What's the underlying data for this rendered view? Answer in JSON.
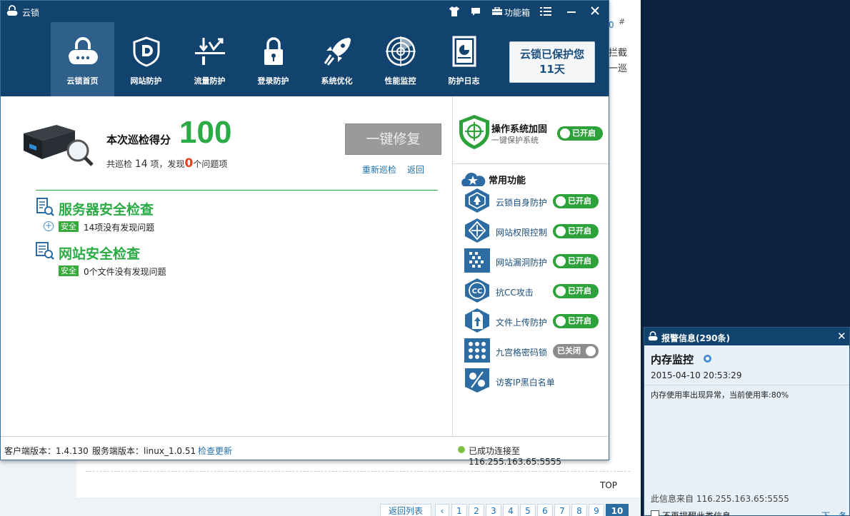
{
  "background": {
    "right_fragments": [
      "拦截",
      "一巡"
    ],
    "reply_number": "0",
    "hash": "#",
    "top_link": "TOP",
    "back_to_list": "返回列表",
    "pages": [
      "1",
      "2",
      "3",
      "4",
      "5",
      "6",
      "7",
      "8",
      "9",
      "10"
    ]
  },
  "window": {
    "title": "云锁",
    "toolbox_label": "功能箱"
  },
  "nav": {
    "items": [
      {
        "label": "云锁首页"
      },
      {
        "label": "网站防护"
      },
      {
        "label": "流量防护"
      },
      {
        "label": "登录防护"
      },
      {
        "label": "系统优化"
      },
      {
        "label": "性能监控"
      },
      {
        "label": "防护日志"
      }
    ],
    "protect_line1": "云锁已保护您",
    "protect_line2": "11天"
  },
  "score": {
    "label": "本次巡检得分",
    "value": "100",
    "summary_prefix": "共巡检",
    "checked_count": "14",
    "summary_mid": "项，发现",
    "issue_count": "0",
    "summary_suffix": "个问题项",
    "fix_button": "一键修复",
    "recheck_link": "重新巡检",
    "back_link": "返回"
  },
  "sections": {
    "server": {
      "title": "服务器安全检查",
      "badge": "安全",
      "desc": "14项没有发现问题"
    },
    "website": {
      "title": "网站安全检查",
      "badge": "安全",
      "desc": "0个文件没有发现问题"
    }
  },
  "os_harden": {
    "title": "操作系统加固",
    "subtitle": "一键保护系统",
    "status": "已开启"
  },
  "common": {
    "title": "常用功能",
    "features": [
      {
        "label": "云锁自身防护",
        "status": "已开启",
        "on": true
      },
      {
        "label": "网站权限控制",
        "status": "已开启",
        "on": true
      },
      {
        "label": "网站漏洞防护",
        "status": "已开启",
        "on": true
      },
      {
        "label": "抗CC攻击",
        "status": "已开启",
        "on": true
      },
      {
        "label": "文件上传防护",
        "status": "已开启",
        "on": true
      },
      {
        "label": "九宫格密码锁",
        "status": "已关闭",
        "on": false
      },
      {
        "label": "访客IP黑白名单",
        "status": "",
        "on": null
      }
    ]
  },
  "statusbar": {
    "client_version": "客户端版本：1.4.130",
    "server_version": "服务端版本：linux_1.0.51",
    "check_update": "检查更新",
    "connection": "已成功连接至 116.255.163.65:5555"
  },
  "alert": {
    "title": "报警信息(290条)",
    "name": "内存监控",
    "time": "2015-04-10 20:53:29",
    "message": "内存使用率出现异常，当前使用率:80%",
    "source": "此信息来自 116.255.163.65:5555",
    "checkbox_label": "不再提醒此类信息",
    "next": "下一条"
  },
  "colors": {
    "brand_dark": "#12436f",
    "score_green": "#2bab45",
    "toggle_on": "#2da13a",
    "toggle_off": "#8c8c8c",
    "link_blue": "#1f6fb2"
  }
}
